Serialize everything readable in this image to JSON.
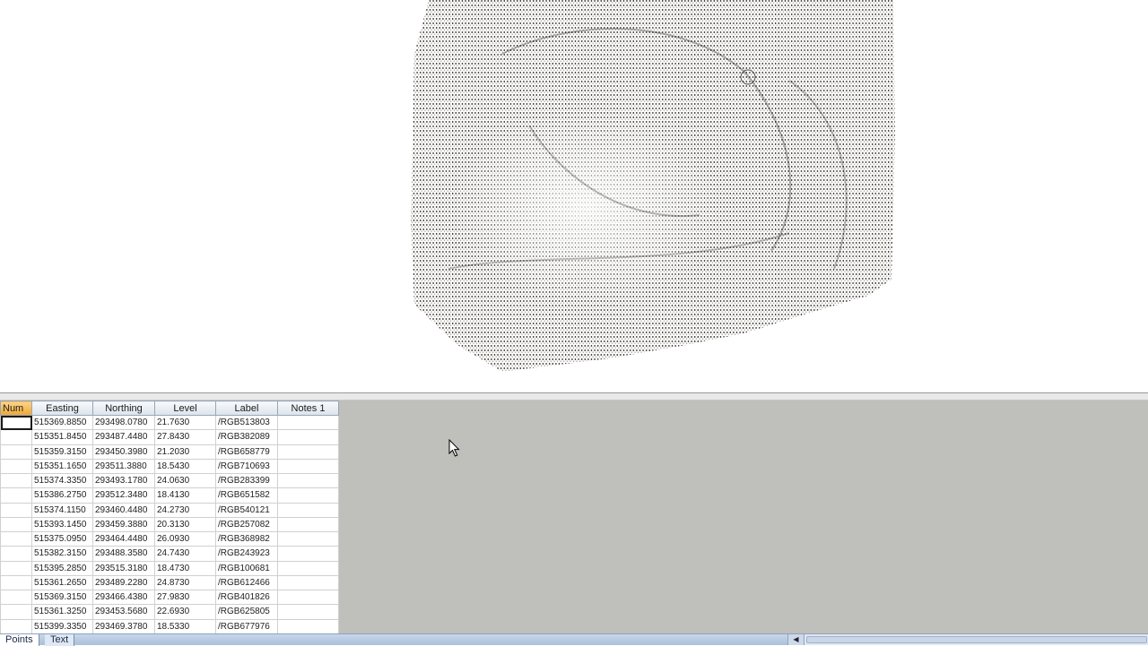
{
  "columns": [
    "Num",
    "Easting",
    "Northing",
    "Level",
    "Label",
    "Notes 1"
  ],
  "rows": [
    [
      "",
      "515369.8850",
      "293498.0780",
      "21.7630",
      "/RGB513803",
      ""
    ],
    [
      "",
      "515351.8450",
      "293487.4480",
      "27.8430",
      "/RGB382089",
      ""
    ],
    [
      "",
      "515359.3150",
      "293450.3980",
      "21.2030",
      "/RGB658779",
      ""
    ],
    [
      "",
      "515351.1650",
      "293511.3880",
      "18.5430",
      "/RGB710693",
      ""
    ],
    [
      "",
      "515374.3350",
      "293493.1780",
      "24.0630",
      "/RGB283399",
      ""
    ],
    [
      "",
      "515386.2750",
      "293512.3480",
      "18.4130",
      "/RGB651582",
      ""
    ],
    [
      "",
      "515374.1150",
      "293460.4480",
      "24.2730",
      "/RGB540121",
      ""
    ],
    [
      "",
      "515393.1450",
      "293459.3880",
      "20.3130",
      "/RGB257082",
      ""
    ],
    [
      "",
      "515375.0950",
      "293464.4480",
      "26.0930",
      "/RGB368982",
      ""
    ],
    [
      "",
      "515382.3150",
      "293488.3580",
      "24.7430",
      "/RGB243923",
      ""
    ],
    [
      "",
      "515395.2850",
      "293515.3180",
      "18.4730",
      "/RGB100681",
      ""
    ],
    [
      "",
      "515361.2650",
      "293489.2280",
      "24.8730",
      "/RGB612466",
      ""
    ],
    [
      "",
      "515369.3150",
      "293466.4380",
      "27.9830",
      "/RGB401826",
      ""
    ],
    [
      "",
      "515361.3250",
      "293453.5680",
      "22.6930",
      "/RGB625805",
      ""
    ],
    [
      "",
      "515399.3350",
      "293469.3780",
      "18.5330",
      "/RGB677976",
      ""
    ]
  ],
  "tabs": {
    "points": "Points",
    "text": "Text"
  },
  "icons": {
    "scroll_left": "scroll-left-arrow-icon",
    "cursor": "mouse-pointer-icon"
  },
  "colors": {
    "point_cloud": "#2e2a22",
    "grid_background": "#bfbfbc",
    "active_header": "#f0a72f"
  }
}
